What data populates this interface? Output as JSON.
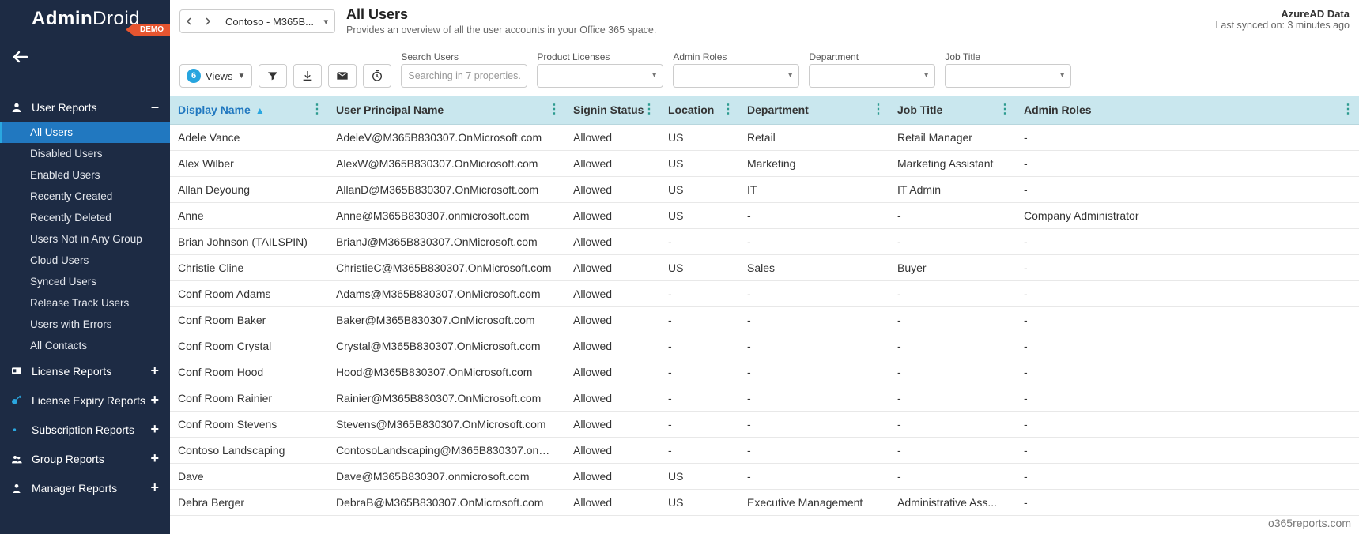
{
  "brand": {
    "name1": "Admin",
    "name2": "Droid",
    "demo": "DEMO"
  },
  "sidebar": {
    "sections": [
      {
        "icon": "user",
        "label": "User Reports",
        "expanded": true,
        "toggle": "–",
        "items": [
          {
            "label": "All Users",
            "active": true
          },
          {
            "label": "Disabled Users"
          },
          {
            "label": "Enabled Users"
          },
          {
            "label": "Recently Created"
          },
          {
            "label": "Recently Deleted"
          },
          {
            "label": "Users Not in Any Group"
          },
          {
            "label": "Cloud Users"
          },
          {
            "label": "Synced Users"
          },
          {
            "label": "Release Track Users"
          },
          {
            "label": "Users with Errors"
          },
          {
            "label": "All Contacts"
          }
        ]
      },
      {
        "icon": "badge",
        "label": "License Reports",
        "toggle": "+"
      },
      {
        "icon": "key",
        "label": "License Expiry Reports",
        "toggle": "+"
      },
      {
        "icon": "dot",
        "label": "Subscription Reports",
        "toggle": "+"
      },
      {
        "icon": "group",
        "label": "Group Reports",
        "toggle": "+"
      },
      {
        "icon": "person",
        "label": "Manager Reports",
        "toggle": "+"
      }
    ]
  },
  "header": {
    "tenant": "Contoso - M365B...",
    "title": "All Users",
    "subtitle": "Provides an overview of all the user accounts in your Office 365 space.",
    "source": "AzureAD Data",
    "sync_label": "Last synced on: ",
    "sync_value": "3 minutes ago"
  },
  "toolbar": {
    "views_count": "6",
    "views_label": "Views",
    "search_label": "Search Users",
    "search_placeholder": "Searching in 7 properties.",
    "filters": [
      {
        "label": "Product Licenses"
      },
      {
        "label": "Admin Roles"
      },
      {
        "label": "Department"
      },
      {
        "label": "Job Title"
      }
    ]
  },
  "table": {
    "columns": [
      "Display Name",
      "User Principal Name",
      "Signin Status",
      "Location",
      "Department",
      "Job Title",
      "Admin Roles"
    ],
    "rows": [
      {
        "name": "Adele Vance",
        "upn": "AdeleV@M365B830307.OnMicrosoft.com",
        "signin": "Allowed",
        "loc": "US",
        "dept": "Retail",
        "job": "Retail Manager",
        "roles": "-"
      },
      {
        "name": "Alex Wilber",
        "upn": "AlexW@M365B830307.OnMicrosoft.com",
        "signin": "Allowed",
        "loc": "US",
        "dept": "Marketing",
        "job": "Marketing Assistant",
        "roles": "-"
      },
      {
        "name": "Allan Deyoung",
        "upn": "AllanD@M365B830307.OnMicrosoft.com",
        "signin": "Allowed",
        "loc": "US",
        "dept": "IT",
        "job": "IT Admin",
        "roles": "-"
      },
      {
        "name": "Anne",
        "upn": "Anne@M365B830307.onmicrosoft.com",
        "signin": "Allowed",
        "loc": "US",
        "dept": "-",
        "job": "-",
        "roles": "Company Administrator"
      },
      {
        "name": "Brian Johnson (TAILSPIN)",
        "upn": "BrianJ@M365B830307.OnMicrosoft.com",
        "signin": "Allowed",
        "loc": "-",
        "dept": "-",
        "job": "-",
        "roles": "-"
      },
      {
        "name": "Christie Cline",
        "upn": "ChristieC@M365B830307.OnMicrosoft.com",
        "signin": "Allowed",
        "loc": "US",
        "dept": "Sales",
        "job": "Buyer",
        "roles": "-"
      },
      {
        "name": "Conf Room Adams",
        "upn": "Adams@M365B830307.OnMicrosoft.com",
        "signin": "Allowed",
        "loc": "-",
        "dept": "-",
        "job": "-",
        "roles": "-"
      },
      {
        "name": "Conf Room Baker",
        "upn": "Baker@M365B830307.OnMicrosoft.com",
        "signin": "Allowed",
        "loc": "-",
        "dept": "-",
        "job": "-",
        "roles": "-"
      },
      {
        "name": "Conf Room Crystal",
        "upn": "Crystal@M365B830307.OnMicrosoft.com",
        "signin": "Allowed",
        "loc": "-",
        "dept": "-",
        "job": "-",
        "roles": "-"
      },
      {
        "name": "Conf Room Hood",
        "upn": "Hood@M365B830307.OnMicrosoft.com",
        "signin": "Allowed",
        "loc": "-",
        "dept": "-",
        "job": "-",
        "roles": "-"
      },
      {
        "name": "Conf Room Rainier",
        "upn": "Rainier@M365B830307.OnMicrosoft.com",
        "signin": "Allowed",
        "loc": "-",
        "dept": "-",
        "job": "-",
        "roles": "-"
      },
      {
        "name": "Conf Room Stevens",
        "upn": "Stevens@M365B830307.OnMicrosoft.com",
        "signin": "Allowed",
        "loc": "-",
        "dept": "-",
        "job": "-",
        "roles": "-"
      },
      {
        "name": "Contoso Landscaping",
        "upn": "ContosoLandscaping@M365B830307.onmicro...",
        "signin": "Allowed",
        "loc": "-",
        "dept": "-",
        "job": "-",
        "roles": "-"
      },
      {
        "name": "Dave",
        "upn": "Dave@M365B830307.onmicrosoft.com",
        "signin": "Allowed",
        "loc": "US",
        "dept": "-",
        "job": "-",
        "roles": "-"
      },
      {
        "name": "Debra Berger",
        "upn": "DebraB@M365B830307.OnMicrosoft.com",
        "signin": "Allowed",
        "loc": "US",
        "dept": "Executive Management",
        "job": "Administrative Ass...",
        "roles": "-"
      }
    ]
  },
  "watermark": "o365reports.com"
}
